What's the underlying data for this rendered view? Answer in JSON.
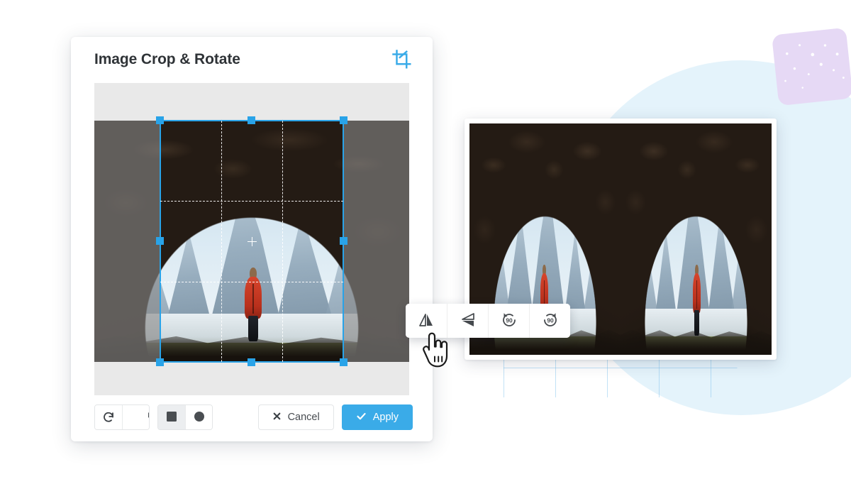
{
  "app": {
    "title": "Image Crop & Rotate",
    "header_icon": "crop-icon",
    "accent_color": "#3aabe8",
    "card_bg": "#ffffff",
    "canvas_bg": "#e9e9e9",
    "dim_overlay_color": "rgba(135,135,135,0.62)",
    "crop_outline_color": "#29a3e8",
    "handle_color": "#29a3e8"
  },
  "canvas": {
    "name": "crop-canvas",
    "photo_alt": "Hiker in red jacket standing in a cave opening facing snowy mountain peaks",
    "crop_grid": "rule-of-thirds",
    "handles": [
      "top-left",
      "top-center",
      "top-right",
      "middle-left",
      "middle-right",
      "bottom-left",
      "bottom-center",
      "bottom-right"
    ],
    "center_marker": "crosshair-icon"
  },
  "toolbar": {
    "rotate_left": {
      "label": "",
      "icon": "rotate-left-icon"
    },
    "rotate_right": {
      "label": "",
      "icon": "rotate-right-icon"
    },
    "shape_square": {
      "label": "",
      "icon": "square-icon",
      "active": true
    },
    "shape_circle": {
      "label": "",
      "icon": "circle-icon",
      "active": false
    },
    "cancel": {
      "label": "Cancel",
      "icon": "close-icon"
    },
    "apply": {
      "label": "Apply",
      "icon": "check-icon"
    }
  },
  "float_toolbar": {
    "items": [
      {
        "name": "flip-horizontal",
        "icon": "flip-horizontal-icon",
        "label": ""
      },
      {
        "name": "flip-vertical",
        "icon": "flip-vertical-icon",
        "label": ""
      },
      {
        "name": "rotate-ccw-90",
        "icon": "rotate-left-90-icon",
        "label": "90"
      },
      {
        "name": "rotate-cw-90",
        "icon": "rotate-right-90-icon",
        "label": "90"
      }
    ]
  },
  "preview": {
    "name": "result-preview",
    "alt": "Mirrored result: the cave photo flipped horizontally and joined with the original"
  },
  "decor": {
    "circle_color": "#e4f3fb",
    "grid_color": "#78bee b",
    "sticker_color": "#e6d9f5"
  },
  "cursor": {
    "type": "pointing-hand-cursor"
  }
}
